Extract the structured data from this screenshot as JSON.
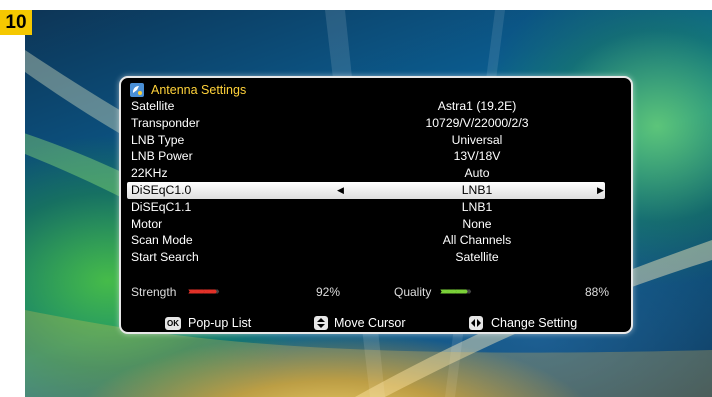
{
  "badge": "10",
  "window": {
    "title": "Antenna Settings",
    "icon": "satellite-dish-icon"
  },
  "settings": [
    {
      "label": "Satellite",
      "value": "Astra1 (19.2E)"
    },
    {
      "label": "Transponder",
      "value": "10729/V/22000/2/3"
    },
    {
      "label": "LNB Type",
      "value": "Universal"
    },
    {
      "label": "LNB Power",
      "value": "13V/18V"
    },
    {
      "label": "22KHz",
      "value": "Auto"
    },
    {
      "label": "DiSEqC1.0",
      "value": "LNB1",
      "selected": true
    },
    {
      "label": "DiSEqC1.1",
      "value": "LNB1"
    },
    {
      "label": "Motor",
      "value": "None"
    },
    {
      "label": "Scan Mode",
      "value": "All Channels"
    },
    {
      "label": "Start Search",
      "value": "Satellite"
    }
  ],
  "signal": {
    "strength_label": "Strength",
    "strength_value": "92%",
    "strength_level": 0.92,
    "strength_color": "#e8332a",
    "quality_label": "Quality",
    "quality_value": "88%",
    "quality_level": 0.88,
    "quality_color": "#7ed63a"
  },
  "help": {
    "ok_key": "OK",
    "popup": "Pop-up List",
    "move": "Move Cursor",
    "change": "Change Setting"
  }
}
